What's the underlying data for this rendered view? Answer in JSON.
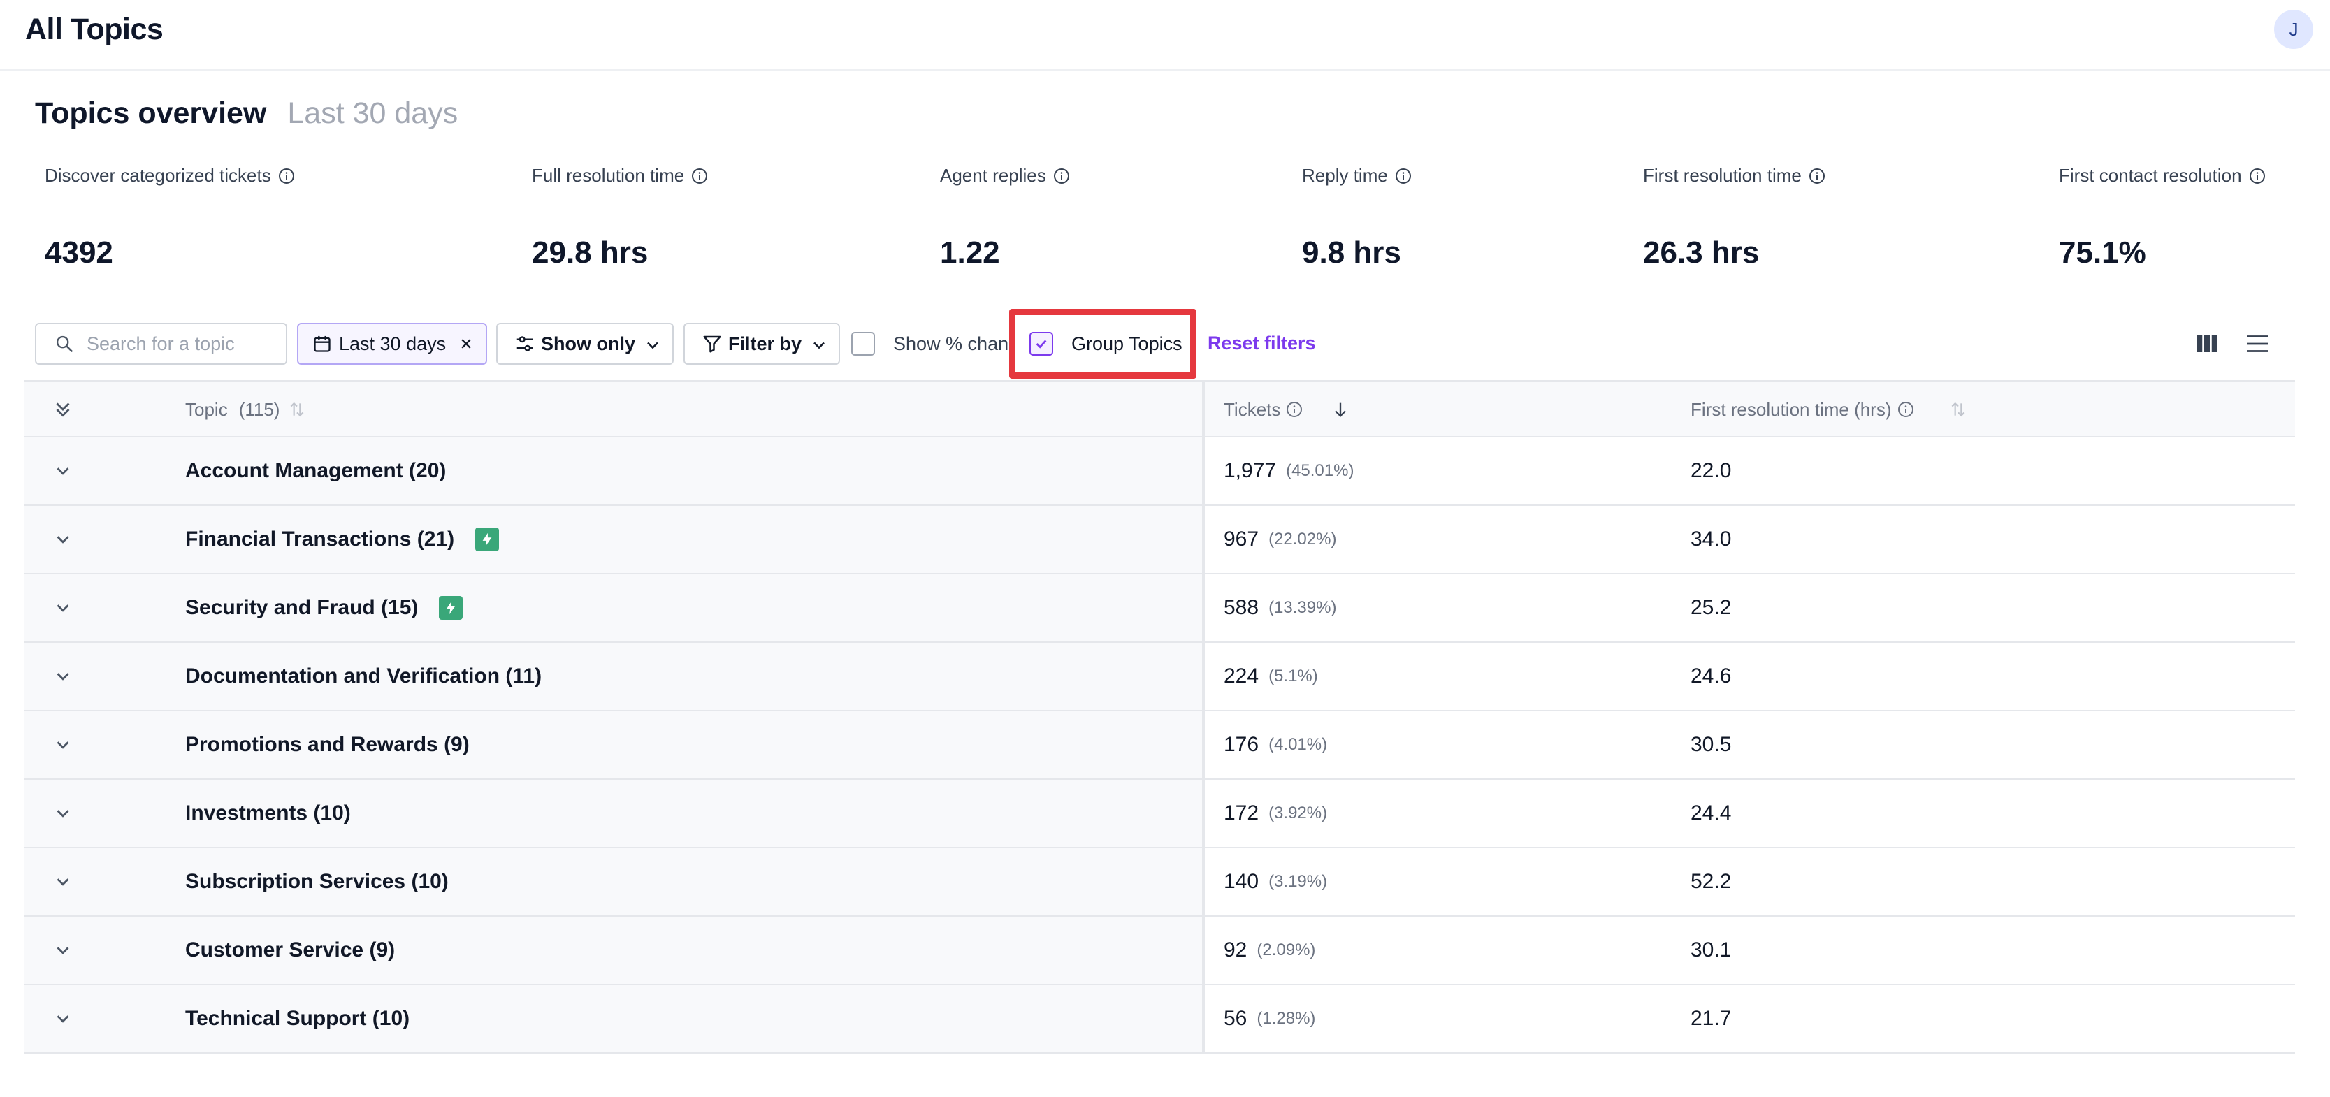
{
  "header": {
    "title": "All Topics",
    "avatar_initial": "J"
  },
  "overview": {
    "title": "Topics overview",
    "range": "Last 30 days"
  },
  "metrics": [
    {
      "label": "Discover categorized tickets",
      "value": "4392"
    },
    {
      "label": "Full resolution time",
      "value": "29.8 hrs"
    },
    {
      "label": "Agent replies",
      "value": "1.22"
    },
    {
      "label": "Reply time",
      "value": "9.8 hrs"
    },
    {
      "label": "First resolution time",
      "value": "26.3 hrs"
    },
    {
      "label": "First contact resolution",
      "value": "75.1%"
    }
  ],
  "toolbar": {
    "search_placeholder": "Search for a topic",
    "date_filter": "Last 30 days",
    "show_only": "Show only",
    "filter_by": "Filter by",
    "show_pct_change": "Show % chang",
    "group_topics": "Group Topics",
    "group_topics_checked": true,
    "reset_filters": "Reset filters"
  },
  "table": {
    "columns": {
      "topic": "Topic",
      "topic_count": "(115)",
      "tickets": "Tickets",
      "first_resolution": "First resolution time (hrs)"
    },
    "rows": [
      {
        "topic": "Account Management (20)",
        "tickets": "1,977",
        "pct": "(45.01%)",
        "frt": "22.0",
        "badge": false
      },
      {
        "topic": "Financial Transactions (21)",
        "tickets": "967",
        "pct": "(22.02%)",
        "frt": "34.0",
        "badge": true
      },
      {
        "topic": "Security and Fraud (15)",
        "tickets": "588",
        "pct": "(13.39%)",
        "frt": "25.2",
        "badge": true
      },
      {
        "topic": "Documentation and Verification (11)",
        "tickets": "224",
        "pct": "(5.1%)",
        "frt": "24.6",
        "badge": false
      },
      {
        "topic": "Promotions and Rewards (9)",
        "tickets": "176",
        "pct": "(4.01%)",
        "frt": "30.5",
        "badge": false
      },
      {
        "topic": "Investments (10)",
        "tickets": "172",
        "pct": "(3.92%)",
        "frt": "24.4",
        "badge": false
      },
      {
        "topic": "Subscription Services (10)",
        "tickets": "140",
        "pct": "(3.19%)",
        "frt": "52.2",
        "badge": false
      },
      {
        "topic": "Customer Service (9)",
        "tickets": "92",
        "pct": "(2.09%)",
        "frt": "30.1",
        "badge": false
      },
      {
        "topic": "Technical Support (10)",
        "tickets": "56",
        "pct": "(1.28%)",
        "frt": "21.7",
        "badge": false
      }
    ]
  },
  "colors": {
    "accent": "#7c3aed",
    "highlight": "#e5383e",
    "badge": "#3aa779"
  }
}
